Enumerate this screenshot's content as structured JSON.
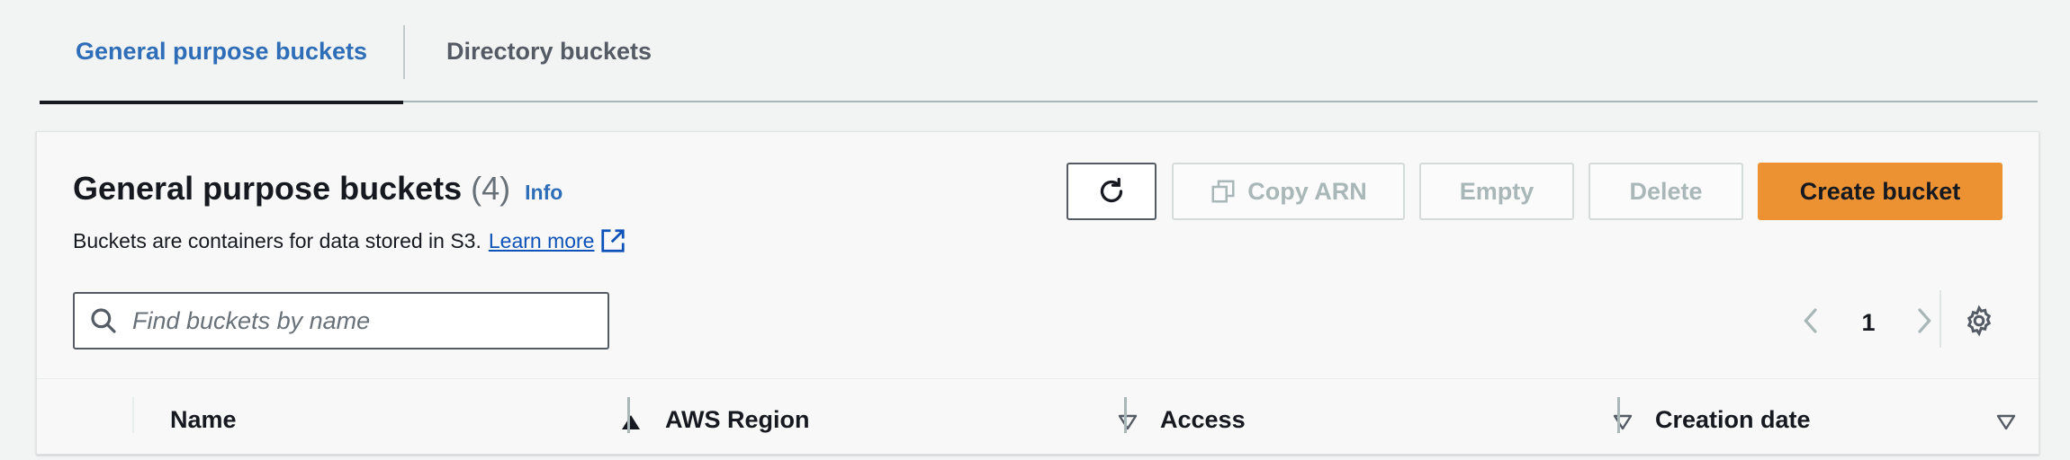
{
  "tabs": [
    {
      "label": "General purpose buckets",
      "active": true
    },
    {
      "label": "Directory buckets",
      "active": false
    }
  ],
  "panel": {
    "title": "General purpose buckets",
    "count": "(4)",
    "info": "Info",
    "description": "Buckets are containers for data stored in S3.",
    "learn_more": "Learn more"
  },
  "toolbar": {
    "copy_arn": "Copy ARN",
    "empty": "Empty",
    "delete": "Delete",
    "create": "Create bucket"
  },
  "search": {
    "placeholder": "Find buckets by name",
    "value": ""
  },
  "pagination": {
    "current_page": "1"
  },
  "table": {
    "columns": [
      {
        "label": "Name",
        "sort": "ascending"
      },
      {
        "label": "AWS Region",
        "sort": "none"
      },
      {
        "label": "Access",
        "sort": "none"
      },
      {
        "label": "Creation date",
        "sort": "none"
      }
    ]
  },
  "colors": {
    "accent": "#2e6db8",
    "primary_button": "#ec9233",
    "link": "#0d52b8",
    "disabled": "#aab7b8"
  },
  "icons": [
    "refresh-icon",
    "copy-icon",
    "external-link-icon",
    "search-icon",
    "chevron-left-icon",
    "chevron-right-icon",
    "gear-icon",
    "sort-ascending-icon",
    "sort-descending-icon"
  ]
}
